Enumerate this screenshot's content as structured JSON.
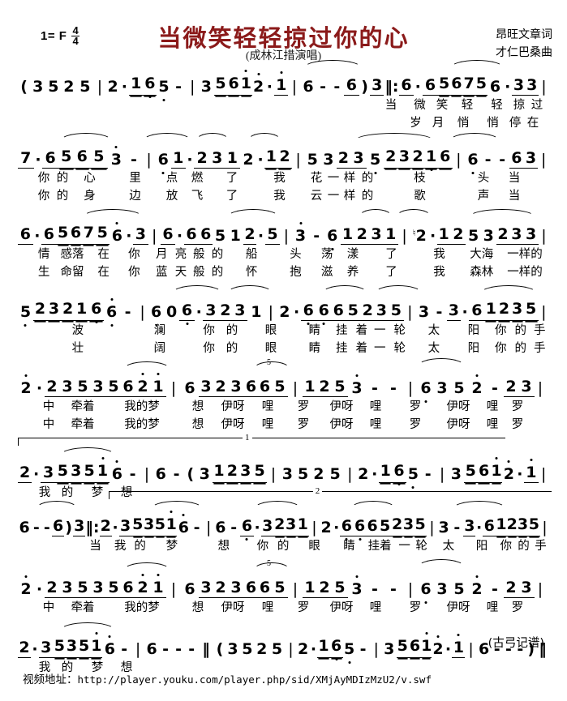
{
  "header": {
    "key_signature": "1= F",
    "time_signature_numerator": "4",
    "time_signature_denominator": "4",
    "title": "当微笑轻轻掠过你的心",
    "subtitle": "(成林江措演唱)",
    "lyricist_credit": "昂旺文章词",
    "composer_credit": "才仁巴桑曲",
    "title_color": "#8b1a1a"
  },
  "footer": {
    "transcriber": "(古弓记谱)",
    "video_label": "视频地址：",
    "video_url": "http://player.youku.com/player.php/sid/XMjAyMDIzMzU2/v.swf"
  },
  "notation": {
    "lines": [
      {
        "id": "line-1",
        "notes": "( 3 5 2 5 | 2 · 16 5 - | 3 561 2 · 1 | 6 - - 6 ) 3 ‖: 6 · 6 5675 6 · 3 3 |",
        "lyrics_1": "当　微　笑轻　　轻　掠过",
        "lyrics_2": "岁　月悄　　悄　停在"
      },
      {
        "id": "line-2",
        "notes": "7 · 6 5 6 5 3 - | 6 1 · 2 3 1 2 · 12 | 5 3 2 3 5 2 3 2 1 6 | 6 - - 6 3 |",
        "lyrics_1": "你 的心　里　　点 燃　了　我　　花一样的 枝　　　头　　当",
        "lyrics_2": "你 的身　边　　放 飞　了　我　　云一样的 歌　　　声　　当"
      },
      {
        "id": "line-3",
        "notes": "6 · 6 5675 6 · 3 | 6 · 6 6 5 1 2 · 5 | 3 - 6 1 2 3 1 | ♮2 · 1 2 5 3 2 3 3 |",
        "lyrics_1": "情 感落　在 你　月 亮般的 船　　头　荡 漾　了　　我　　大海 一样的",
        "lyrics_2": "生 命留　在 你　蓝 天般的 怀　　抱　滋 养　了　　我　　森林 一样的"
      },
      {
        "id": "line-4",
        "notes": "5 2 3 2 1 6 6 - | 6 0 6 · 3 2 3 1 | 2 · 6 6 6 5 2 3 5 | 3 - 3 · 6 1 2 3 5 |",
        "lyrics_1": "波　　　澜　　你 的 眼　　睛 挂着一轮 太　　阳 你 的手",
        "lyrics_2": "壮　　　阔　　你 的 眼　　睛 挂着一轮 太　　阳 你 的手"
      },
      {
        "id": "line-5",
        "notes": "2 · 2 3 5 3 5 6 2 1 | 6 3 2 3 6 6 5 | 1 2 5 3 - - | 6 3 5 2 - 2 3 |",
        "lyrics_1": "中　牵着 我的梦　　　想 伊呀哩 罗　　伊呀哩 罗　　伊呀哩　罗",
        "lyrics_2": "中　牵着 我的梦　　　想 伊呀哩 罗　　伊呀哩 罗　　伊呀哩　罗"
      },
      {
        "id": "line-6",
        "notes": "2 · 3 5351 6 - | 6 - ( 3 1 2 3 5 | 3 5 2 5 | 2 · 16 5 - | 3 561 2 · 1 |",
        "lyrics_1": "我 的梦　　想",
        "lyrics_2": ""
      },
      {
        "id": "line-7",
        "notes": "6 - - 6 ) 3 ‖: 2 · 3 5351 6 - | 6 - 6 · 3 231 | 2 · 6 6 6 5 235 | 3 - 3 · 6 1235 |",
        "lyrics_1": "当　我 的梦　　想　　　你 的眼　　睛 挂着 一轮太　　阳　你 的手",
        "lyrics_2": ""
      },
      {
        "id": "line-8",
        "notes": "2 · 2 3 5 3 5 6 2 1 | 6 3 2 3 6 6 5 | 1 2 5 3 - - | 6 3 5 2 - 2 3 |",
        "lyrics_1": "中　牵着 我的梦　　　想 伊呀哩 罗　　伊呀哩　罗　　伊呀哩　罗",
        "lyrics_2": ""
      },
      {
        "id": "line-9",
        "notes": "2 · 3 5351 6 - | 6 - - - ‖ ( 3 5 2 5 | 2 · 16 5 - | 3 561 2 · 1 | 6 - - - ) ‖",
        "lyrics_1": "我 的梦　　想",
        "lyrics_2": ""
      }
    ],
    "volta_1_label": "1",
    "volta_2_label": "2",
    "tuplet_label": "5"
  }
}
